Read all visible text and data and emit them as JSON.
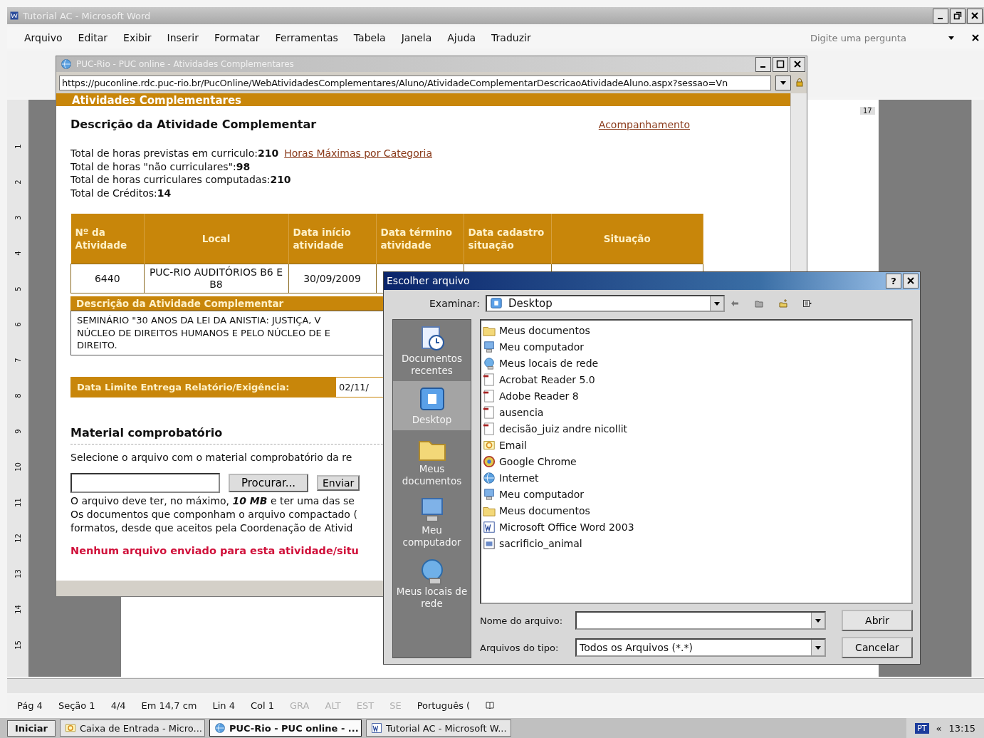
{
  "word_window": {
    "title": "Tutorial AC - Microsoft Word",
    "menu": [
      "Arquivo",
      "Editar",
      "Exibir",
      "Inserir",
      "Formatar",
      "Ferramentas",
      "Tabela",
      "Janela",
      "Ajuda",
      "Traduzir"
    ],
    "help_box": {
      "placeholder": "Digite uma pergunta"
    },
    "top_ruler": "17",
    "ruler_numbers": [
      "1",
      "2",
      "3",
      "4",
      "5",
      "6",
      "7",
      "8",
      "9",
      "10",
      "11",
      "12",
      "13",
      "14",
      "15"
    ]
  },
  "browser": {
    "title": "PUC-Rio - PUC online - Atividades Complementares",
    "address": "https://puconline.rdc.puc-rio.br/PucOnline/WebAtividadesComplementares/Aluno/AtividadeComplementarDescricaoAtividadeAluno.aspx?sessao=Vn",
    "banner": "Atividades Complementares",
    "heading": "Descrição da Atividade Complementar",
    "top_link": "Acompanhamento",
    "totals": [
      {
        "label": "Total de horas previstas em curriculo:",
        "value": "210",
        "link": "Horas Máximas por Categoria"
      },
      {
        "label": "Total de horas \"não curriculares\":",
        "value": "98"
      },
      {
        "label": "Total de horas curriculares computadas:",
        "value": "210"
      },
      {
        "label": "Total de Créditos:",
        "value": "14"
      }
    ],
    "table": {
      "columns": [
        "Nº da Atividade",
        "Local",
        "Data início atividade",
        "Data término atividade",
        "Data cadastro situação",
        "Situação"
      ],
      "rows": [
        [
          "6440",
          "PUC-RIO AUDITÓRIOS B6 E B8",
          "30/09/2009"
        ]
      ]
    },
    "description_header": "Descrição da Atividade Complementar",
    "description_lines": [
      "SEMINÁRIO \"30 ANOS DA LEI DA ANISTIA: JUSTIÇA, V",
      "NÚCLEO DE DIREITOS HUMANOS E PELO NÚCLEO DE E",
      "DIREITO."
    ],
    "deadline": {
      "label": "Data Limite Entrega Relatório/Exigência:",
      "value": "02/11/"
    },
    "material": {
      "heading": "Material comprobatório",
      "instruction": "Selecione o arquivo com o material comprobatório da re",
      "browse_button": "Procurar...",
      "send_button": "Enviar",
      "note_lines": [
        "O arquivo deve ter, no máximo, **10 MB** e ter uma das se",
        "Os documentos que componham o arquivo compactado (",
        "formatos, desde que aceitos pela Coordenação de Ativid"
      ],
      "warning": "Nenhum arquivo enviado para esta atividade/situ"
    }
  },
  "dialog": {
    "title": "Escolher arquivo",
    "look_in_label": "Examinar:",
    "look_in": "Desktop",
    "places": [
      {
        "label": "Documentos recentes",
        "kind": "recent",
        "selected": false
      },
      {
        "label": "Desktop",
        "kind": "desktop",
        "selected": true
      },
      {
        "label": "Meus documentos",
        "kind": "documents",
        "selected": false
      },
      {
        "label": "Meu computador",
        "kind": "computer",
        "selected": false
      },
      {
        "label": "Meus locais de rede",
        "kind": "network",
        "selected": false
      }
    ],
    "files": [
      {
        "name": "Meus documentos",
        "kind": "folder"
      },
      {
        "name": "Meu computador",
        "kind": "computer"
      },
      {
        "name": "Meus locais de rede",
        "kind": "network"
      },
      {
        "name": "Acrobat Reader 5.0",
        "kind": "pdf"
      },
      {
        "name": "Adobe Reader 8",
        "kind": "pdf"
      },
      {
        "name": "ausencia",
        "kind": "pdf"
      },
      {
        "name": "decisão_juiz andre nicollit",
        "kind": "pdf"
      },
      {
        "name": "Email",
        "kind": "mail"
      },
      {
        "name": "Google Chrome",
        "kind": "app"
      },
      {
        "name": "Internet",
        "kind": "browser"
      },
      {
        "name": "Meu computador",
        "kind": "computer"
      },
      {
        "name": "Meus documentos",
        "kind": "folder"
      },
      {
        "name": "Microsoft Office Word 2003",
        "kind": "word"
      },
      {
        "name": "sacrificio_animal",
        "kind": "image"
      }
    ],
    "help_button": "?",
    "filename_label": "Nome do arquivo:",
    "filetype_label": "Arquivos do tipo:",
    "filetype": "Todos os Arquivos (*.*)",
    "buttons": [
      "Abrir",
      "Cancelar"
    ]
  },
  "status_bar": [
    {
      "text": "Pág 4",
      "disabled": false
    },
    {
      "text": "Seção 1",
      "disabled": false
    },
    {
      "text": "4/4",
      "disabled": false
    },
    {
      "text": "Em 14,7 cm",
      "disabled": false
    },
    {
      "text": "Lin 4",
      "disabled": false
    },
    {
      "text": "Col 1",
      "disabled": false
    },
    {
      "text": "GRA",
      "disabled": true
    },
    {
      "text": "ALT",
      "disabled": true
    },
    {
      "text": "EST",
      "disabled": true
    },
    {
      "text": "SE",
      "disabled": true
    },
    {
      "text": "Português (",
      "disabled": false
    }
  ],
  "taskbar": {
    "start": "Iniciar",
    "tasks": [
      {
        "label": "Caixa de Entrada - Micro...",
        "kind": "mail",
        "selected": false
      },
      {
        "label": "PUC-Rio - PUC online - ...",
        "kind": "browser",
        "selected": true
      },
      {
        "label": "Tutorial AC - Microsoft W...",
        "kind": "word",
        "selected": false
      }
    ],
    "language": "PT",
    "tray_toggle": "«",
    "clock": "13:15"
  }
}
